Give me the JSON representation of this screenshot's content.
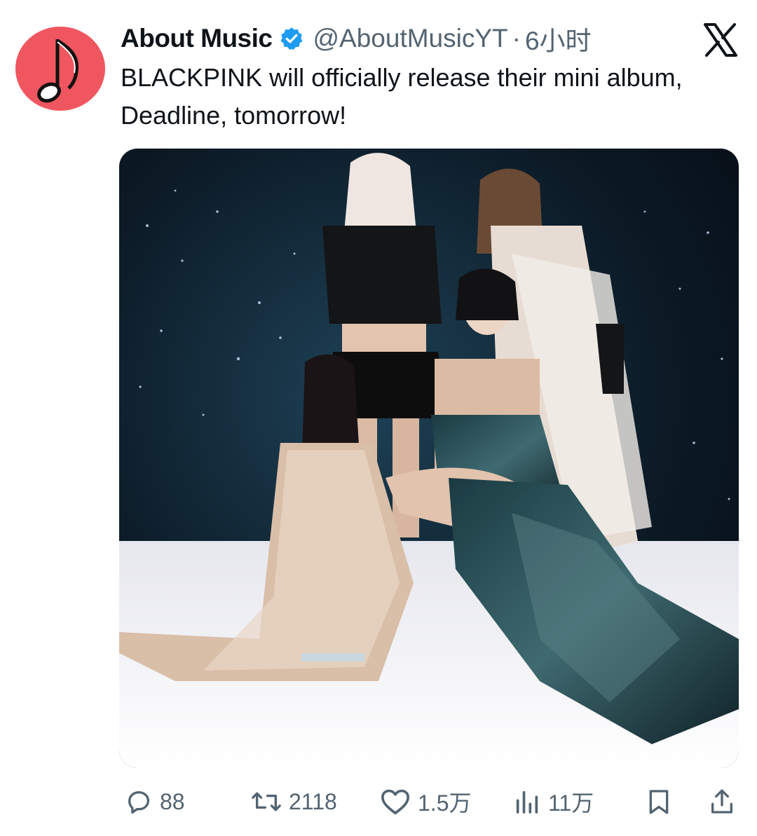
{
  "post": {
    "author_name": "About Music",
    "author_handle": "@AboutMusicYT",
    "separator": "·",
    "timestamp": "6小时",
    "text": "BLACKPINK will officially release their mini album, Deadline, tomorrow!",
    "verified_icon": "verified-badge-icon",
    "platform_icon": "x-logo-icon",
    "media_description_icon": "photo-image"
  },
  "actions": {
    "replies": "88",
    "reposts": "2118",
    "likes": "1.5万",
    "views": "11万"
  },
  "colors": {
    "avatar_bg": "#f0565f",
    "verified_blue": "#1d9bf0",
    "muted_text": "#536471"
  }
}
